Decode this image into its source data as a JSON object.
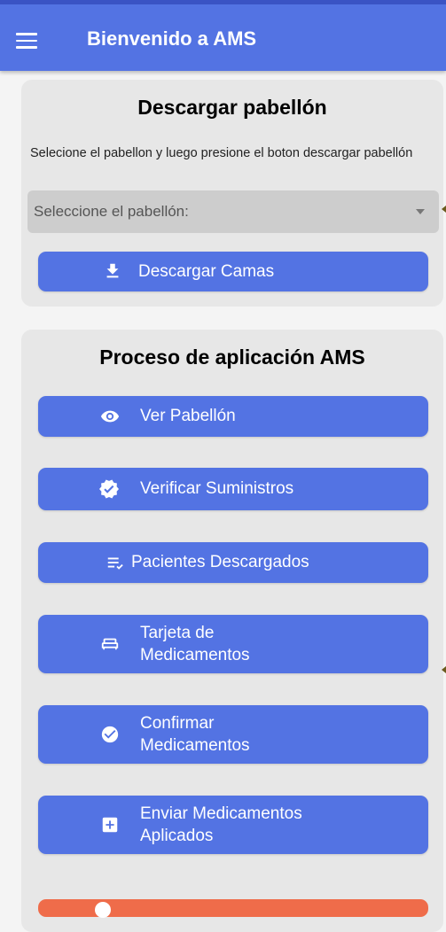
{
  "header": {
    "title": "Bienvenido a AMS",
    "menu_icon": "hamburger-menu-icon",
    "background": "#5373e3"
  },
  "download_section": {
    "title": "Descargar pabellón",
    "instructions": "Selecione el pabellon y luego presione el boton descargar pabellón",
    "select_placeholder": "Seleccione el pabellón:",
    "download_button": {
      "label": "Descargar Camas",
      "icon": "download-icon"
    }
  },
  "process_section": {
    "title": "Proceso de aplicación AMS",
    "buttons": [
      {
        "label_line1": "Ver Pabellón",
        "label_line2": "",
        "icon": "eye-icon"
      },
      {
        "label_line1": "Verificar Suministros",
        "label_line2": "",
        "icon": "verified-badge-icon"
      },
      {
        "label_line1": "Pacientes Descargados",
        "label_line2": "",
        "icon": "checklist-icon"
      },
      {
        "label_line1": "Tarjeta de",
        "label_line2": "Medicamentos",
        "icon": "bed-icon"
      },
      {
        "label_line1": "Confirmar",
        "label_line2": "Medicamentos",
        "icon": "check-circle-icon"
      },
      {
        "label_line1": "Enviar Medicamentos",
        "label_line2": "Aplicados",
        "icon": "plus-box-icon"
      }
    ]
  },
  "colors": {
    "primary": "#5373e3",
    "card": "#e7e7e7",
    "danger": "#ef6c4a"
  }
}
